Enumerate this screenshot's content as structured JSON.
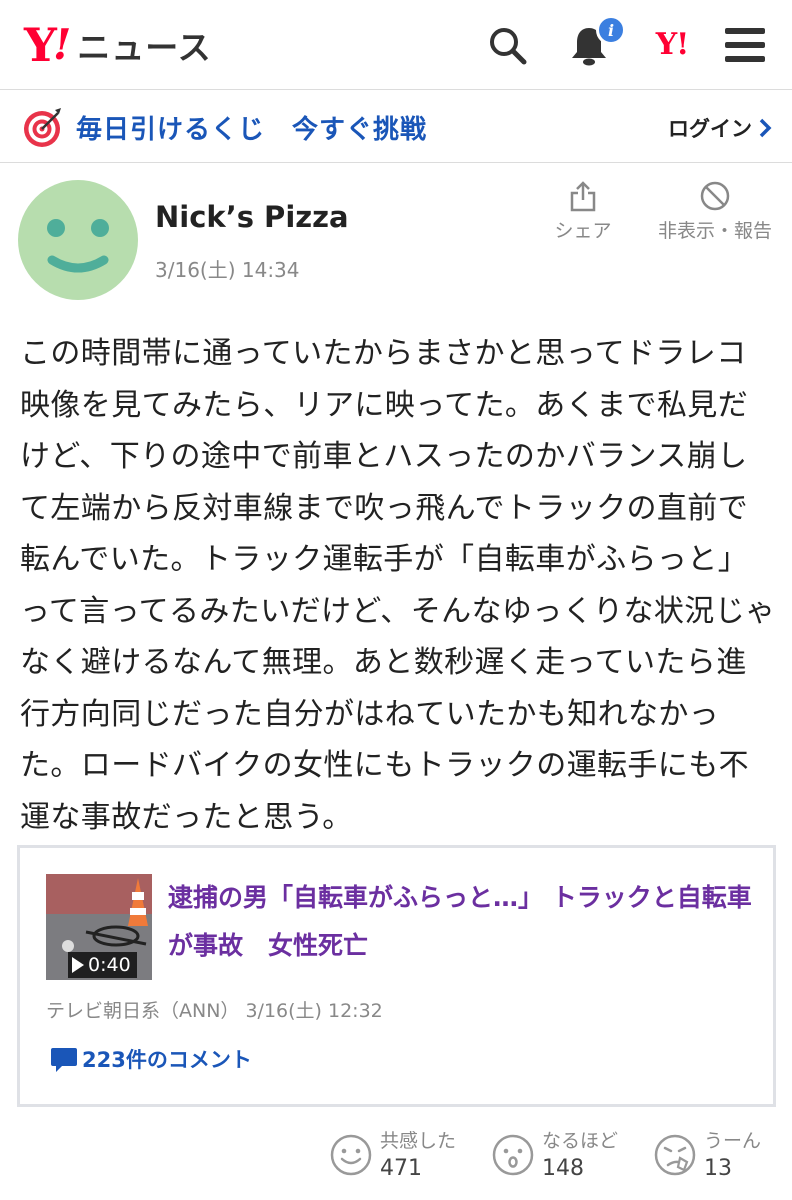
{
  "header": {
    "logo_mark": "Y",
    "logo_exclaim": "!",
    "logo_text": "ニュース",
    "notification_badge": "i",
    "yj_mark": "Y!"
  },
  "lottery": {
    "text": "毎日引けるくじ　今すぐ挑戦",
    "login_label": "ログイン"
  },
  "comment": {
    "author": "Nick’s Pizza",
    "date": "3/16(土) 14:34",
    "share_label": "シェア",
    "hide_report_label": "非表示・報告",
    "body": "この時間帯に通っていたからまさかと思ってドラレコ映像を見てみたら、リアに映ってた。あくまで私見だけど、下りの途中で前車とハスったのかバランス崩して左端から反対車線まで吹っ飛んでトラックの直前で転んでいた。トラック運転手が「自転車がふらっと」って言ってるみたいだけど、そんなゆっくりな状況じゃなく避けるなんて無理。あと数秒遅く走っていたら進行方向同じだった自分がはねていたかも知れなかった。ロードバイクの女性にもトラックの運転手にも不運な事故だったと思う。"
  },
  "article": {
    "duration": "0:40",
    "title": "逮捕の男「自転車がふらっと…」 トラックと自転車が事故　女性死亡",
    "source": "テレビ朝日系（ANN） 3/16(土) 12:32",
    "comments_label": "223件のコメント"
  },
  "reactions": [
    {
      "label": "共感した",
      "count": "471"
    },
    {
      "label": "なるほど",
      "count": "148"
    },
    {
      "label": "うーん",
      "count": "13"
    }
  ],
  "colors": {
    "brand_red": "#ff0033",
    "link_blue": "#1a56b8",
    "article_purple": "#6b2fa0",
    "avatar_green": "#b7ddae",
    "avatar_face": "#4fae9a",
    "badge_blue": "#3b7fe0"
  }
}
